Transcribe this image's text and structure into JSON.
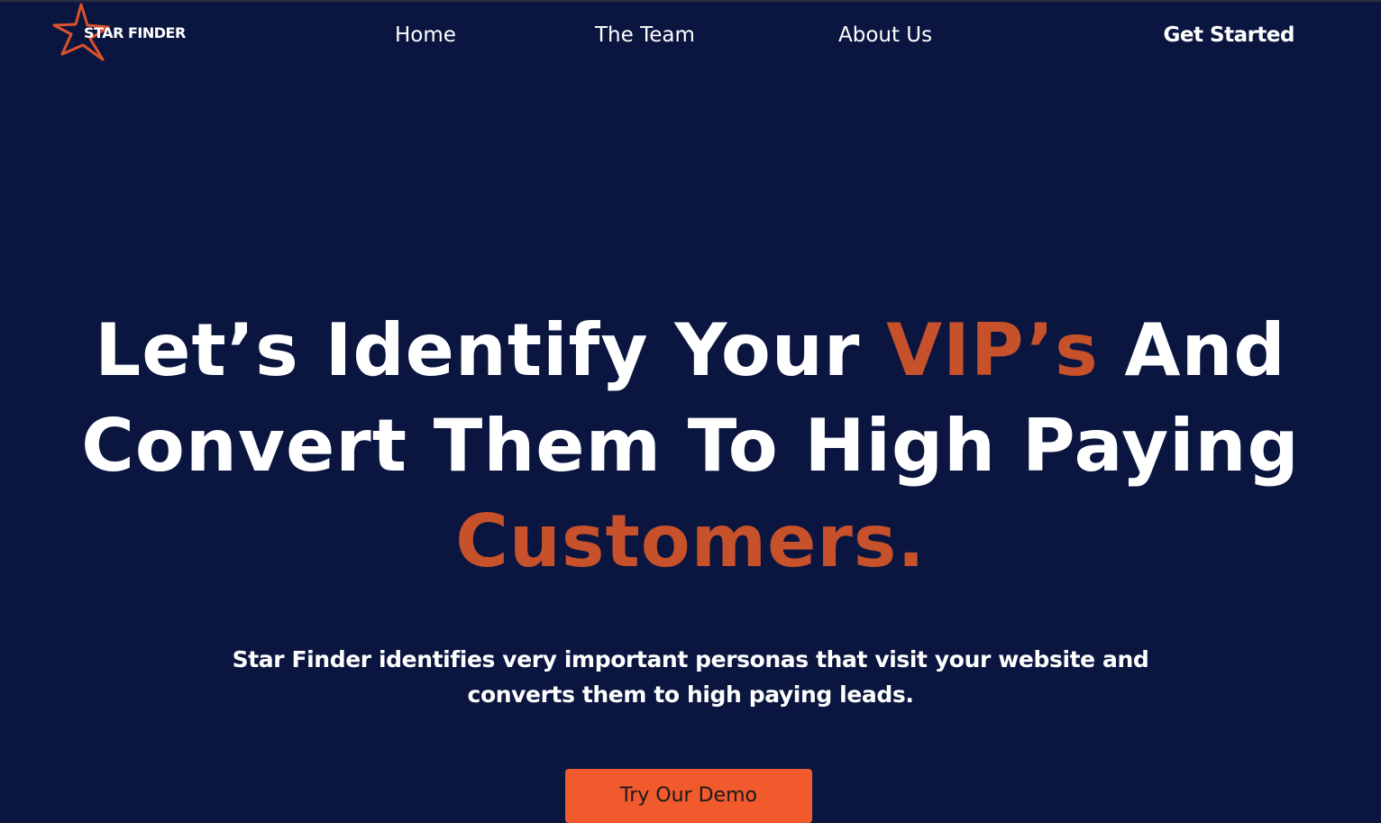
{
  "brand": {
    "name": "Star Finder",
    "logo_text": "Star Finder",
    "logo_icon": "star-icon",
    "accent_color": "#c6512a",
    "background_color": "#0b1640"
  },
  "nav": {
    "home": "Home",
    "team": "The Team",
    "about": "About Us",
    "cta": "Get Started"
  },
  "hero": {
    "title_part1": "Let’s Identify Your ",
    "title_accent1": "VIP’s",
    "title_part2": " And Convert Them To High Paying ",
    "title_accent2": "Customers.",
    "subtitle": "Star Finder identifies very important personas that visit your website and converts them to high paying leads.",
    "button_label": "Try Our Demo",
    "button_color": "#f05a2c"
  }
}
